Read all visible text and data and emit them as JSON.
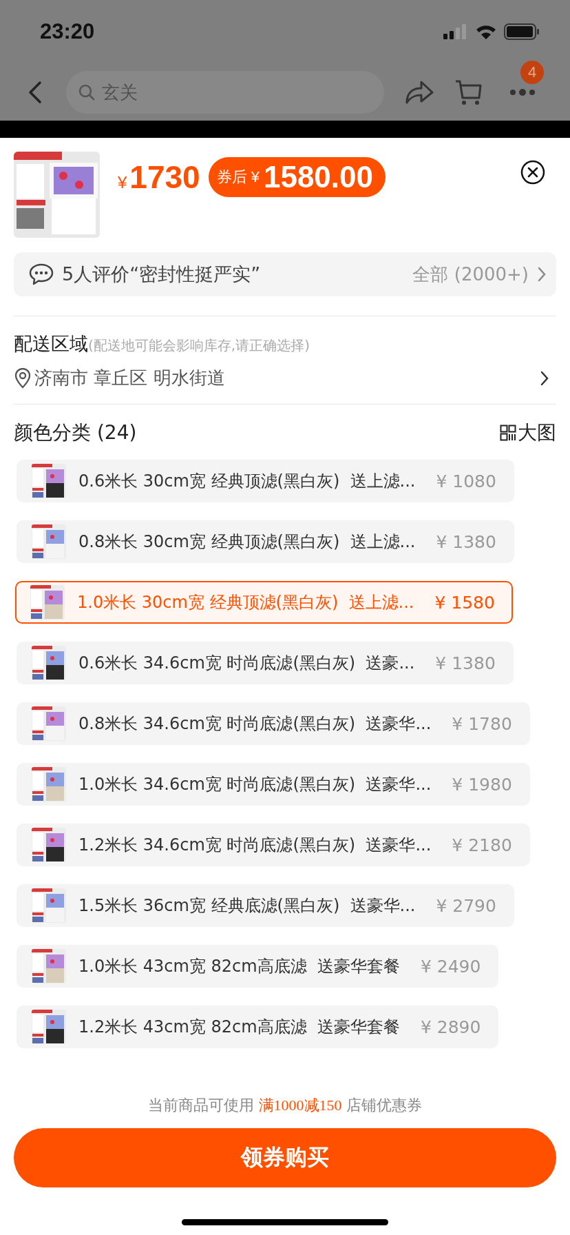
{
  "status_bar": {
    "time": "23:20"
  },
  "nav": {
    "search": {
      "placeholder": "玄关"
    },
    "badge": "4"
  },
  "product": {
    "currency": "¥",
    "price": "1730",
    "coupon_label": "券后",
    "coupon_currency": "¥",
    "coupon_price": "1580.00"
  },
  "review": {
    "text": "5人评价“密封性挺严实”",
    "link": "全部 (2000+)"
  },
  "delivery": {
    "title": "配送区域",
    "note": "(配送地可能会影响库存,请正确选择)",
    "address": "济南市 章丘区 明水街道"
  },
  "variants": {
    "title": "颜色分类 (24)",
    "view_toggle": "大图",
    "items": [
      {
        "label": "0.6米长 30cm宽 经典顶滤(黑白灰)  送上滤...",
        "price": "¥ 1080",
        "selected": false
      },
      {
        "label": "0.8米长 30cm宽 经典顶滤(黑白灰)  送上滤...",
        "price": "¥ 1380",
        "selected": false
      },
      {
        "label": "1.0米长 30cm宽 经典顶滤(黑白灰)  送上滤...",
        "price": "¥ 1580",
        "selected": true
      },
      {
        "label": "0.6米长 34.6cm宽 时尚底滤(黑白灰)  送豪...",
        "price": "¥ 1380",
        "selected": false
      },
      {
        "label": "0.8米长 34.6cm宽 时尚底滤(黑白灰)  送豪华...",
        "price": "¥ 1780",
        "selected": false
      },
      {
        "label": "1.0米长 34.6cm宽 时尚底滤(黑白灰)  送豪华...",
        "price": "¥ 1980",
        "selected": false
      },
      {
        "label": "1.2米长 34.6cm宽 时尚底滤(黑白灰)  送豪华...",
        "price": "¥ 2180",
        "selected": false
      },
      {
        "label": "1.5米长 36cm宽 经典底滤(黑白灰)  送豪华...",
        "price": "¥ 2790",
        "selected": false
      },
      {
        "label": "1.0米长 43cm宽 82cm高底滤  送豪华套餐",
        "price": "¥ 2490",
        "selected": false
      },
      {
        "label": "1.2米长 43cm宽 82cm高底滤  送豪华套餐",
        "price": "¥ 2890",
        "selected": false
      }
    ]
  },
  "coupon_note": {
    "before": "当前商品可使用",
    "highlight": "满1000减150",
    "after": "店铺优惠券"
  },
  "buy_button": "领券购买"
}
